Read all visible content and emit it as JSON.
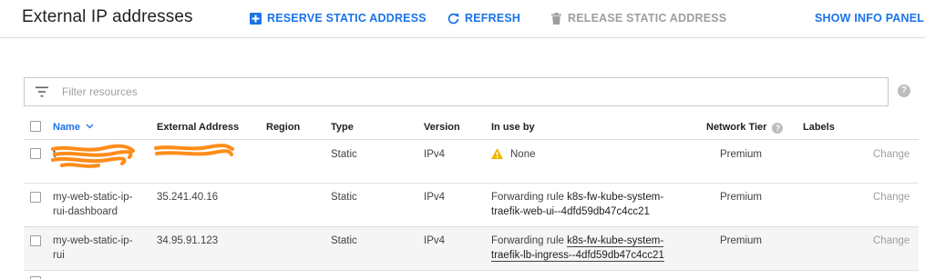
{
  "toolbar": {
    "title": "External IP addresses",
    "reserve_label": "RESERVE STATIC ADDRESS",
    "refresh_label": "REFRESH",
    "release_label": "RELEASE STATIC ADDRESS",
    "info_panel_label": "SHOW INFO PANEL",
    "reserve_icon": "plus-box-icon",
    "refresh_icon": "refresh-icon",
    "release_icon": "trash-icon"
  },
  "filter": {
    "placeholder": "Filter resources",
    "value": ""
  },
  "colors": {
    "accent": "#1a73e8",
    "disabled": "#9e9e9e",
    "warning": "#f4b400",
    "redaction": "#ff8c1a"
  },
  "table": {
    "columns": {
      "name": "Name",
      "external_address": "External Address",
      "region": "Region",
      "type": "Type",
      "version": "Version",
      "in_use_by": "In use by",
      "network_tier": "Network Tier",
      "labels": "Labels"
    },
    "sort_indicator": "chevron-down-icon",
    "rows": [
      {
        "name_1": "t",
        "name_2": "",
        "address": "",
        "region": "",
        "type": "Static",
        "version": "IPv4",
        "in_use_prefix": "None",
        "in_use_link_1": "",
        "in_use_link_2": "",
        "network_tier": "Premium",
        "action": "Change",
        "redacted": true
      },
      {
        "name_1": "my-web-static-ip-",
        "name_2": "rui-dashboard",
        "address": "35.241.40.16",
        "region": "",
        "type": "Static",
        "version": "IPv4",
        "in_use_prefix": "Forwarding rule",
        "in_use_link_1": "k8s-fw-kube-system-",
        "in_use_link_2": "traefik-web-ui--4dfd59db47c4cc21",
        "network_tier": "Premium",
        "action": "Change"
      },
      {
        "name_1": "my-web-static-ip-",
        "name_2": "rui",
        "address": "34.95.91.123",
        "region": "",
        "type": "Static",
        "version": "IPv4",
        "in_use_prefix": "Forwarding rule",
        "in_use_link_1": "k8s-fw-kube-system-",
        "in_use_link_2": "traefik-lb-ingress--4dfd59db47c4cc21",
        "network_tier": "Premium",
        "action": "Change"
      }
    ]
  }
}
